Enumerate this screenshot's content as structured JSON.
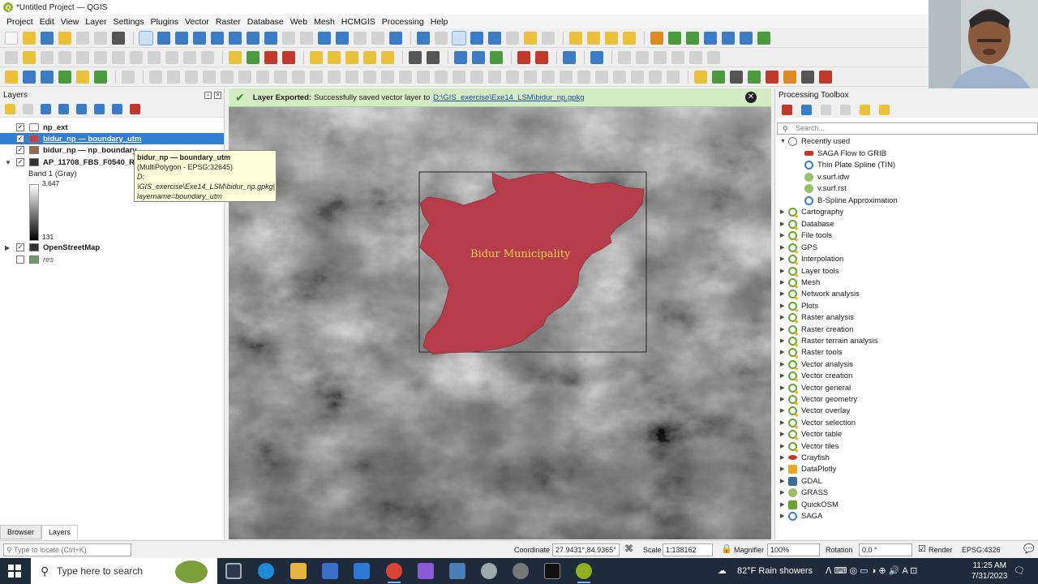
{
  "window": {
    "title": "*Untitled Project — QGIS"
  },
  "menu": [
    "Project",
    "Edit",
    "View",
    "Layer",
    "Settings",
    "Plugins",
    "Vector",
    "Raster",
    "Database",
    "Web",
    "Mesh",
    "HCMGIS",
    "Processing",
    "Help"
  ],
  "layers_panel": {
    "title": "Layers",
    "layers": [
      {
        "name": "np_ext",
        "checked": true,
        "symbol": "polygon-outline"
      },
      {
        "name": "bidur_np — boundary_utm",
        "checked": true,
        "selected": true,
        "color": "#c0414b"
      },
      {
        "name": "bidur_np — np_boundary",
        "checked": true,
        "color": "#a0694e"
      },
      {
        "name": "AP_11708_FBS_F0540_RT",
        "checked": true,
        "symbol": "raster-icon"
      },
      {
        "name": "Band 1 (Gray)"
      },
      {
        "name": "3,647"
      },
      {
        "name": "131"
      },
      {
        "name": "OpenStreetMap",
        "checked": true,
        "symbol": "raster-icon"
      },
      {
        "name": "res",
        "checked": false,
        "color": "#6c9b6a"
      }
    ],
    "tooltip": {
      "line1": "bidur_np — boundary_utm",
      "line2": "(MultiPolygon - EPSG:32645)",
      "line3": "D:",
      "line4": "\\GIS_exercise\\Exe14_LSM\\bidur_np.gpkg|",
      "line5": "layername=boundary_utm"
    },
    "tabs": [
      "Browser",
      "Layers"
    ]
  },
  "message_bar": {
    "title": "Layer Exported:",
    "text": "Successfully saved vector layer to",
    "link": "D:\\GIS_exercise\\Exe14_LSM\\bidur_np.gpkg"
  },
  "map": {
    "label": "Bidur Municipality",
    "polygon_color": "#b73c4a",
    "label_color": "#f5d44c"
  },
  "toolbox": {
    "title": "Processing Toolbox",
    "search_placeholder": "Search...",
    "recently_used_label": "Recently used",
    "recent": [
      {
        "name": "SAGA Flow to GRIB",
        "icon": "saga-icon"
      },
      {
        "name": "Thin Plate Spline (TIN)",
        "icon": "saga-icon"
      },
      {
        "name": "v.surf.idw",
        "icon": "grass-icon"
      },
      {
        "name": "v.surf.rst",
        "icon": "grass-icon"
      },
      {
        "name": "B-Spline Approximation",
        "icon": "saga-icon"
      }
    ],
    "groups": [
      "Cartography",
      "Database",
      "File tools",
      "GPS",
      "Interpolation",
      "Layer tools",
      "Mesh",
      "Network analysis",
      "Plots",
      "Raster analysis",
      "Raster creation",
      "Raster terrain analysis",
      "Raster tools",
      "Vector analysis",
      "Vector creation",
      "Vector general",
      "Vector geometry",
      "Vector overlay",
      "Vector selection",
      "Vector table",
      "Vector tiles"
    ],
    "providers": [
      {
        "name": "Crayfish",
        "icon": "crayfish-icon"
      },
      {
        "name": "DataPlotly",
        "icon": "dataplotly-icon"
      },
      {
        "name": "GDAL",
        "icon": "gdal-icon"
      },
      {
        "name": "GRASS",
        "icon": "grass-icon"
      },
      {
        "name": "QuickOSM",
        "icon": "quickosm-icon"
      },
      {
        "name": "SAGA",
        "icon": "saga-icon"
      }
    ]
  },
  "statusbar": {
    "locate_placeholder": "Type to locate (Ctrl+K)",
    "coordinate_label": "Coordinate",
    "coordinate": "27.9431°,84.9365°",
    "scale_label": "Scale",
    "scale": "1:138162",
    "magnifier_label": "Magnifier",
    "magnifier": "100%",
    "rotation_label": "Rotation",
    "rotation": "0.0 °",
    "render_label": "Render",
    "crs": "EPSG:4326"
  },
  "taskbar": {
    "search_placeholder": "Type here to search",
    "weather": "82°F  Rain showers",
    "time": "11:25 AM",
    "date": "7/31/2023"
  }
}
